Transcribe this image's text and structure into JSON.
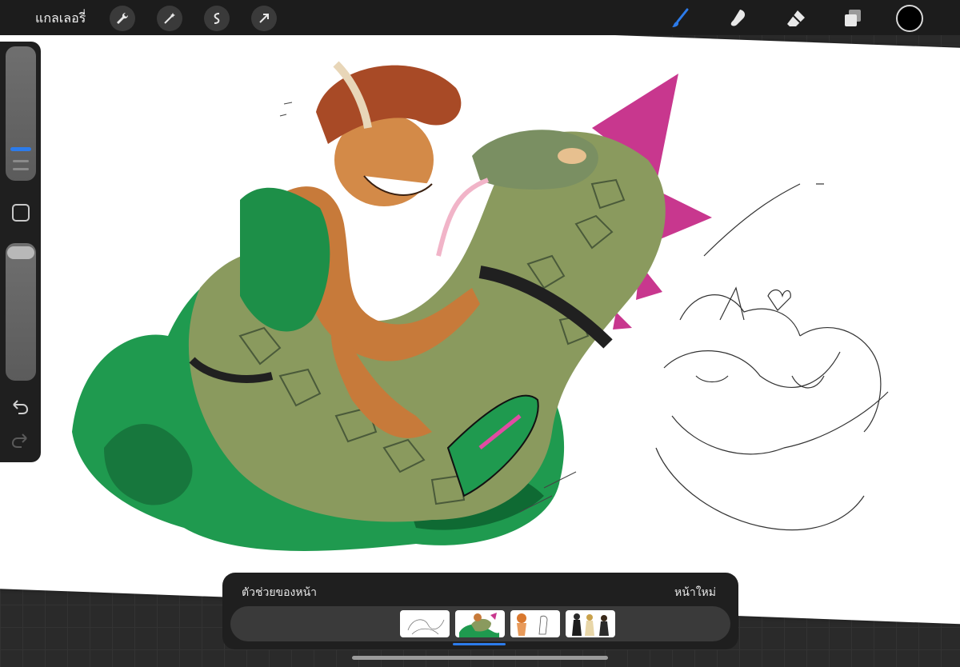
{
  "toolbar": {
    "gallery_label": "แกลเลอรี่",
    "actions_icon": "wrench-icon",
    "adjustments_icon": "magic-wand-icon",
    "selection_icon": "selection-icon",
    "transform_icon": "arrow-icon",
    "brush_icon": "brush-icon",
    "smudge_icon": "smudge-icon",
    "eraser_icon": "eraser-icon",
    "layers_icon": "layers-icon",
    "active_color": "#000000",
    "active_tool_color": "#2c7bea"
  },
  "sidebar": {
    "brush_size_icon": "size-slider",
    "opacity_icon": "opacity-slider",
    "modify_icon": "square-icon",
    "undo_icon": "undo-icon",
    "redo_icon": "redo-icon"
  },
  "page_assist": {
    "title": "ตัวช่วยของหน้า",
    "new_page": "หน้าใหม่",
    "pages": [
      {
        "thumbnail": "sketch"
      },
      {
        "thumbnail": "color-art"
      },
      {
        "thumbnail": "character-art"
      },
      {
        "thumbnail": "figures"
      }
    ],
    "active_page": 2
  }
}
